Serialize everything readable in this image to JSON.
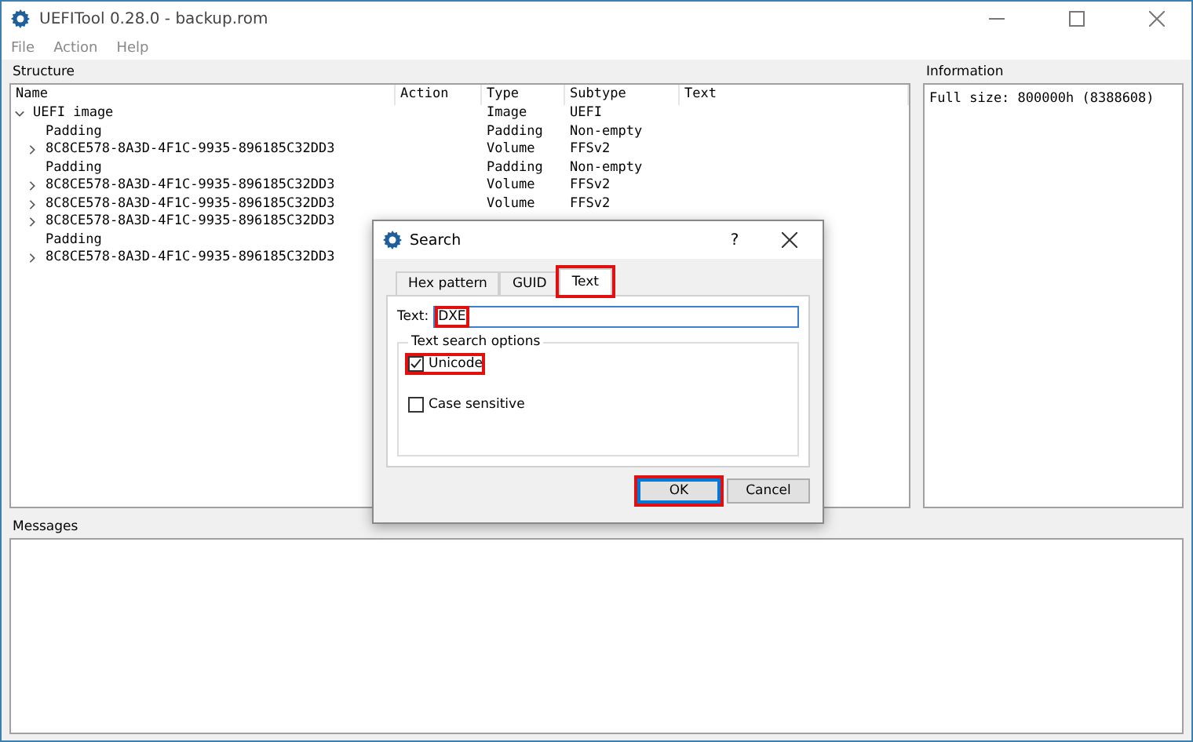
{
  "window": {
    "title": "UEFITool 0.28.0 - backup.rom"
  },
  "menu": [
    "File",
    "Action",
    "Help"
  ],
  "structure": {
    "label": "Structure",
    "columns": [
      "Name",
      "Action",
      "Type",
      "Subtype",
      "Text"
    ],
    "rows": [
      {
        "name": "UEFI image",
        "type": "Image",
        "subtype": "UEFI",
        "expanded": true,
        "children": [
          {
            "name": "Padding",
            "type": "Padding",
            "subtype": "Non-empty"
          },
          {
            "name": "8C8CE578-8A3D-4F1C-9935-896185C32DD3",
            "type": "Volume",
            "subtype": "FFSv2",
            "expanded": false
          },
          {
            "name": "Padding",
            "type": "Padding",
            "subtype": "Non-empty"
          },
          {
            "name": "8C8CE578-8A3D-4F1C-9935-896185C32DD3",
            "type": "Volume",
            "subtype": "FFSv2",
            "expanded": false
          },
          {
            "name": "8C8CE578-8A3D-4F1C-9935-896185C32DD3",
            "type": "Volume",
            "subtype": "FFSv2",
            "expanded": false
          },
          {
            "name": "8C8CE578-8A3D-4F1C-9935-896185C32DD3",
            "expanded": false
          },
          {
            "name": "Padding"
          },
          {
            "name": "8C8CE578-8A3D-4F1C-9935-896185C32DD3",
            "expanded": false
          }
        ]
      }
    ]
  },
  "information": {
    "label": "Information",
    "text": "Full size: 800000h (8388608)"
  },
  "messages": {
    "label": "Messages"
  },
  "dialog": {
    "title": "Search",
    "help": "?",
    "tabs": [
      {
        "label": "Hex pattern",
        "selected": false,
        "highlighted": false
      },
      {
        "label": "GUID",
        "selected": false,
        "highlighted": false
      },
      {
        "label": "Text",
        "selected": true,
        "highlighted": true
      }
    ],
    "text_label": "Text:",
    "text_value": "DXE",
    "text_highlighted": true,
    "group_label": "Text search options",
    "options": [
      {
        "label": "Unicode",
        "checked": true,
        "highlighted": true
      },
      {
        "label": "Case sensitive",
        "checked": false,
        "highlighted": false
      }
    ],
    "buttons": [
      {
        "label": "OK",
        "default": true,
        "highlighted": true
      },
      {
        "label": "Cancel",
        "default": false,
        "highlighted": false
      }
    ]
  }
}
